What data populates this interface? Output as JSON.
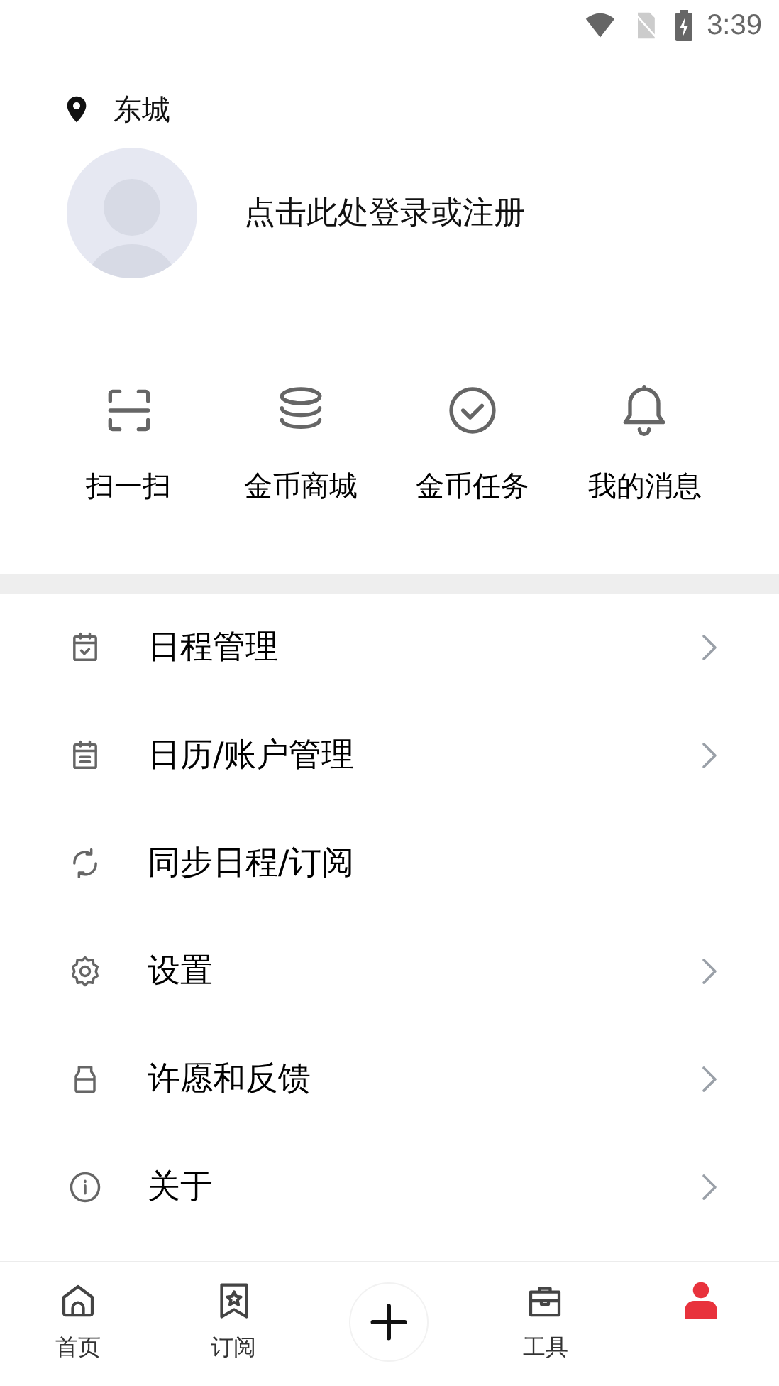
{
  "status_bar": {
    "time": "3:39"
  },
  "location": {
    "label": "东城"
  },
  "profile": {
    "login_prompt": "点击此处登录或注册"
  },
  "quick_actions": [
    {
      "kind": "scan",
      "label": "扫一扫"
    },
    {
      "kind": "coins",
      "label": "金币商城"
    },
    {
      "kind": "check",
      "label": "金币任务"
    },
    {
      "kind": "bell",
      "label": "我的消息"
    }
  ],
  "menu": [
    {
      "kind": "calendar-check",
      "label": "日程管理",
      "has_arrow": true
    },
    {
      "kind": "calendar-list",
      "label": "日历/账户管理",
      "has_arrow": true
    },
    {
      "kind": "sync",
      "label": "同步日程/订阅",
      "has_arrow": false
    },
    {
      "kind": "gear",
      "label": "设置",
      "has_arrow": true
    },
    {
      "kind": "jar",
      "label": "许愿和反馈",
      "has_arrow": true
    },
    {
      "kind": "info",
      "label": "关于",
      "has_arrow": true
    }
  ],
  "bottom_nav": [
    {
      "kind": "home",
      "label": "首页",
      "selected": false
    },
    {
      "kind": "bookmark",
      "label": "订阅",
      "selected": false
    },
    {
      "kind": "add",
      "selected": false
    },
    {
      "kind": "toolbox",
      "label": "工具",
      "selected": false
    },
    {
      "kind": "person",
      "selected": true
    }
  ]
}
